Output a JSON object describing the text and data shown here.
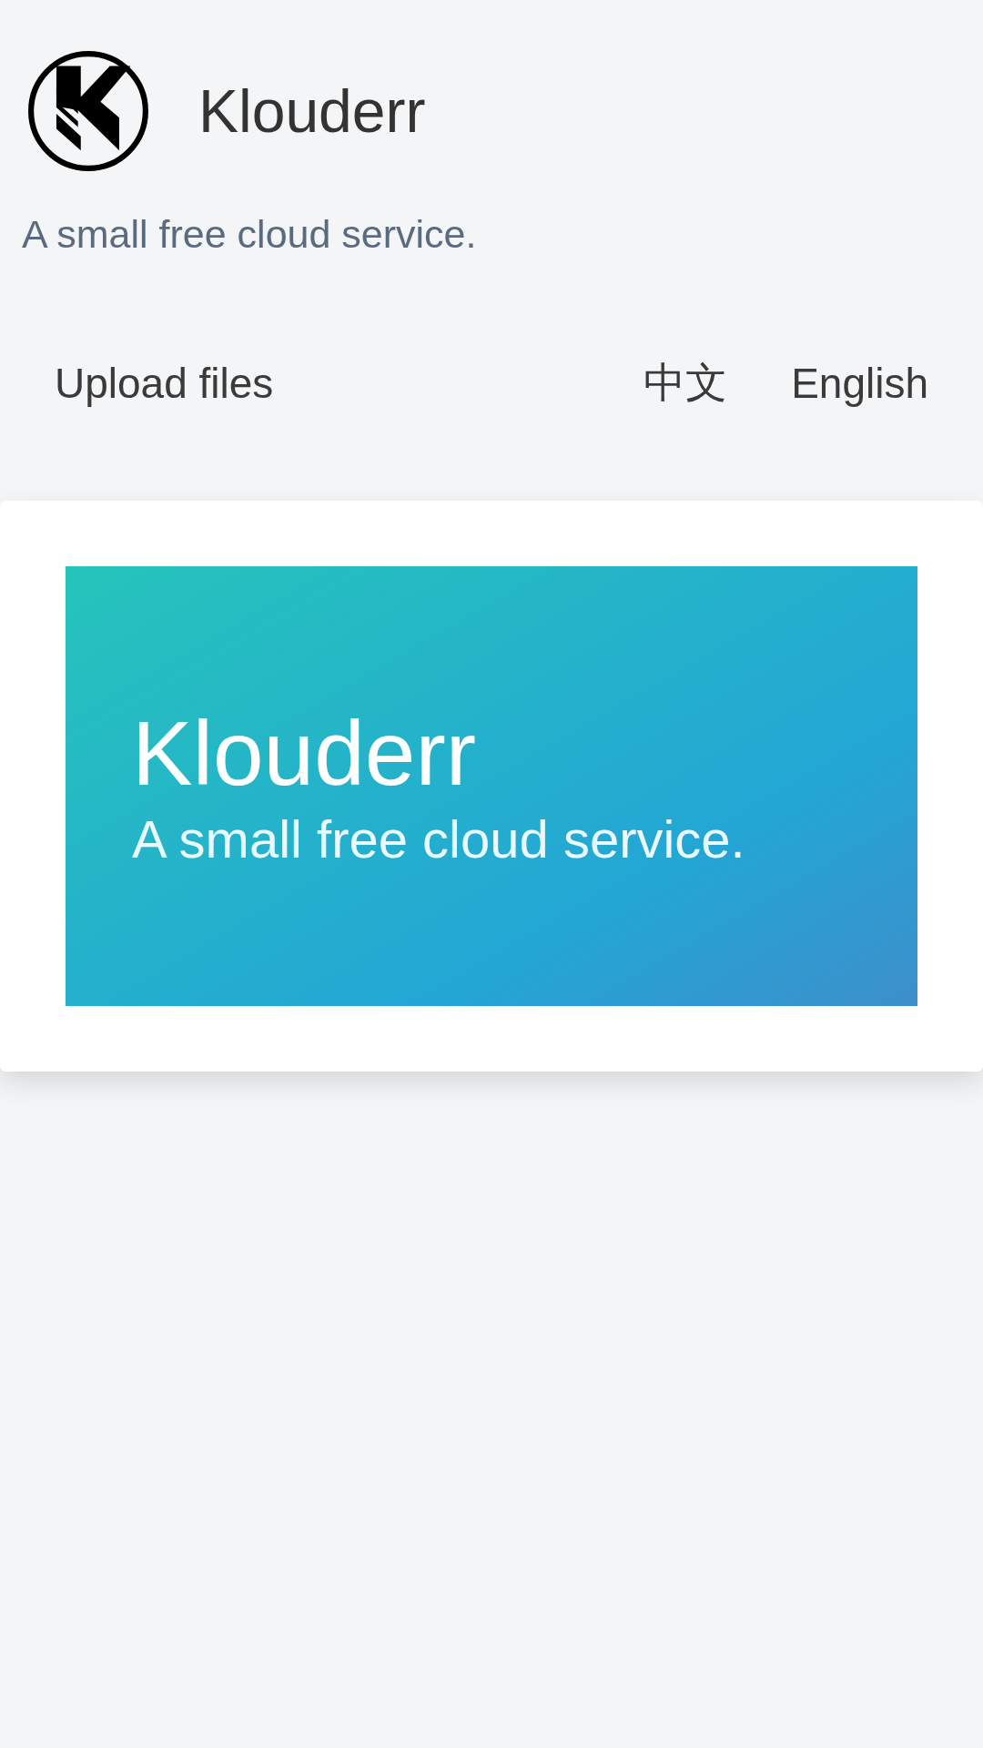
{
  "header": {
    "title": "Klouderr",
    "tagline": "A small free cloud service."
  },
  "nav": {
    "links": [
      {
        "label": "Upload files"
      }
    ],
    "languages": [
      {
        "label": "中文"
      },
      {
        "label": "English"
      }
    ]
  },
  "hero": {
    "title": "Klouderr",
    "subtitle": "A small free cloud service."
  }
}
